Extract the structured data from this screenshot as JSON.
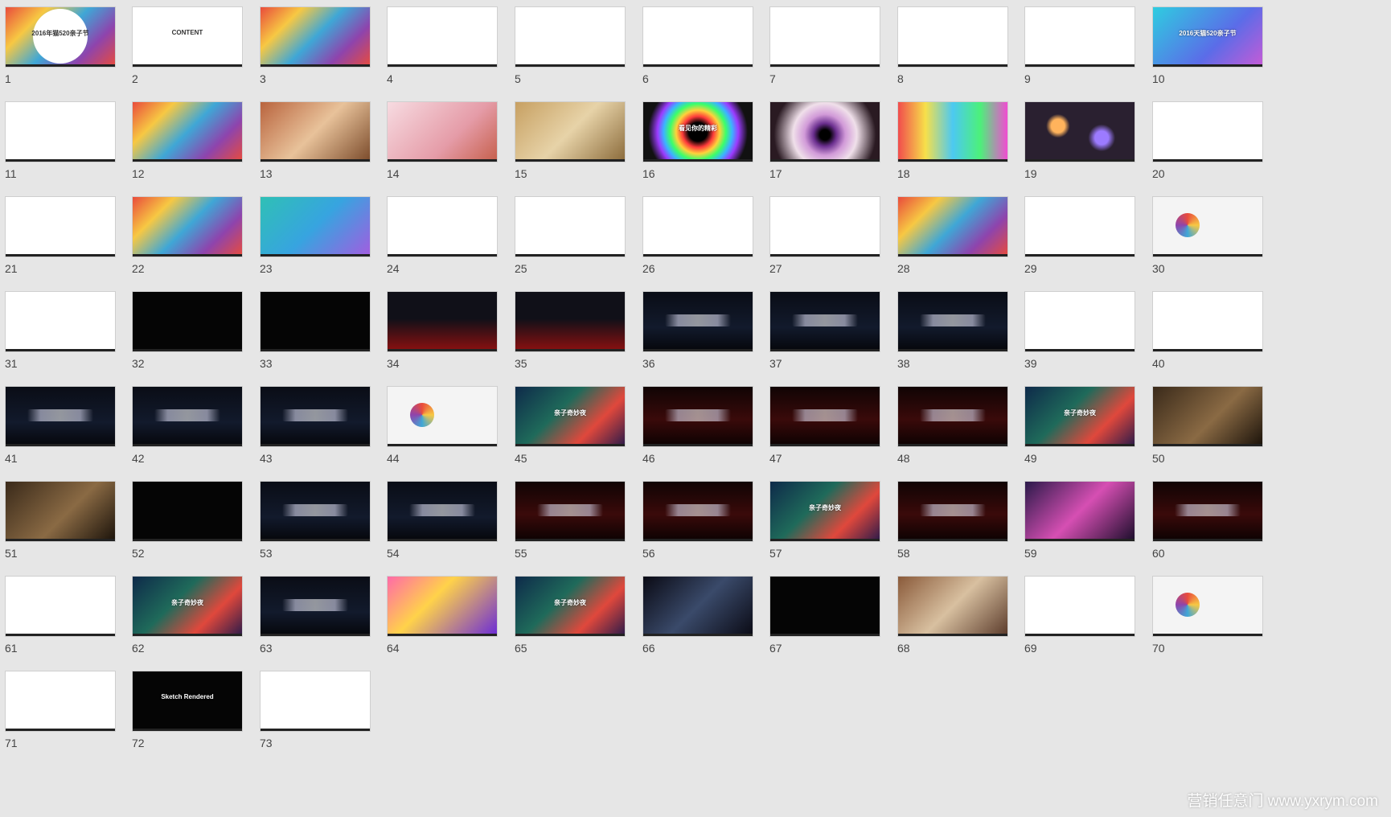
{
  "slides": [
    {
      "num": "1",
      "style": "colorful",
      "caption": "2016年猫520亲子节"
    },
    {
      "num": "2",
      "style": "white",
      "caption": "CONTENT"
    },
    {
      "num": "3",
      "style": "colorful",
      "caption": ""
    },
    {
      "num": "4",
      "style": "white",
      "caption": ""
    },
    {
      "num": "5",
      "style": "white",
      "caption": ""
    },
    {
      "num": "6",
      "style": "white",
      "caption": ""
    },
    {
      "num": "7",
      "style": "white",
      "caption": ""
    },
    {
      "num": "8",
      "style": "white",
      "caption": ""
    },
    {
      "num": "9",
      "style": "white",
      "caption": ""
    },
    {
      "num": "10",
      "style": "cyan",
      "caption": "2016天猫520亲子节"
    },
    {
      "num": "11",
      "style": "white",
      "caption": ""
    },
    {
      "num": "12",
      "style": "colorful",
      "caption": ""
    },
    {
      "num": "13",
      "style": "warm",
      "caption": ""
    },
    {
      "num": "14",
      "style": "pink",
      "caption": ""
    },
    {
      "num": "15",
      "style": "tan",
      "caption": ""
    },
    {
      "num": "16",
      "style": "rainbow",
      "caption": "看见你的精彩"
    },
    {
      "num": "17",
      "style": "eye",
      "caption": ""
    },
    {
      "num": "18",
      "style": "candy",
      "caption": ""
    },
    {
      "num": "19",
      "style": "bokeh",
      "caption": ""
    },
    {
      "num": "20",
      "style": "white",
      "caption": ""
    },
    {
      "num": "21",
      "style": "white",
      "caption": ""
    },
    {
      "num": "22",
      "style": "colorful",
      "caption": ""
    },
    {
      "num": "23",
      "style": "teal",
      "caption": ""
    },
    {
      "num": "24",
      "style": "white",
      "caption": ""
    },
    {
      "num": "25",
      "style": "white",
      "caption": ""
    },
    {
      "num": "26",
      "style": "white",
      "caption": ""
    },
    {
      "num": "27",
      "style": "white",
      "caption": ""
    },
    {
      "num": "28",
      "style": "colorful",
      "caption": ""
    },
    {
      "num": "29",
      "style": "white",
      "caption": ""
    },
    {
      "num": "30",
      "style": "grey",
      "caption": ""
    },
    {
      "num": "31",
      "style": "white",
      "caption": ""
    },
    {
      "num": "32",
      "style": "black",
      "caption": ""
    },
    {
      "num": "33",
      "style": "black",
      "caption": ""
    },
    {
      "num": "34",
      "style": "redfloor",
      "caption": ""
    },
    {
      "num": "35",
      "style": "redfloor",
      "caption": ""
    },
    {
      "num": "36",
      "style": "dark",
      "caption": ""
    },
    {
      "num": "37",
      "style": "dark",
      "caption": ""
    },
    {
      "num": "38",
      "style": "dark",
      "caption": ""
    },
    {
      "num": "39",
      "style": "white",
      "caption": ""
    },
    {
      "num": "40",
      "style": "white",
      "caption": ""
    },
    {
      "num": "41",
      "style": "dark",
      "caption": ""
    },
    {
      "num": "42",
      "style": "dark",
      "caption": ""
    },
    {
      "num": "43",
      "style": "dark",
      "caption": ""
    },
    {
      "num": "44",
      "style": "grey",
      "caption": ""
    },
    {
      "num": "45",
      "style": "jungle",
      "caption": "亲子奇妙夜"
    },
    {
      "num": "46",
      "style": "darkred",
      "caption": ""
    },
    {
      "num": "47",
      "style": "darkred",
      "caption": ""
    },
    {
      "num": "48",
      "style": "darkred",
      "caption": ""
    },
    {
      "num": "49",
      "style": "jungle",
      "caption": "亲子奇妙夜"
    },
    {
      "num": "50",
      "style": "brown",
      "caption": ""
    },
    {
      "num": "51",
      "style": "brown",
      "caption": ""
    },
    {
      "num": "52",
      "style": "black",
      "caption": ""
    },
    {
      "num": "53",
      "style": "dark",
      "caption": ""
    },
    {
      "num": "54",
      "style": "dark",
      "caption": ""
    },
    {
      "num": "55",
      "style": "darkred",
      "caption": ""
    },
    {
      "num": "56",
      "style": "darkred",
      "caption": ""
    },
    {
      "num": "57",
      "style": "jungle",
      "caption": "亲子奇妙夜"
    },
    {
      "num": "58",
      "style": "darkred",
      "caption": ""
    },
    {
      "num": "59",
      "style": "purple",
      "caption": ""
    },
    {
      "num": "60",
      "style": "darkred",
      "caption": ""
    },
    {
      "num": "61",
      "style": "white",
      "caption": ""
    },
    {
      "num": "62",
      "style": "jungle",
      "caption": "亲子奇妙夜"
    },
    {
      "num": "63",
      "style": "dark",
      "caption": ""
    },
    {
      "num": "64",
      "style": "party",
      "caption": ""
    },
    {
      "num": "65",
      "style": "jungle",
      "caption": "亲子奇妙夜"
    },
    {
      "num": "66",
      "style": "dragon",
      "caption": ""
    },
    {
      "num": "67",
      "style": "black",
      "caption": ""
    },
    {
      "num": "68",
      "style": "office",
      "caption": ""
    },
    {
      "num": "69",
      "style": "white",
      "caption": ""
    },
    {
      "num": "70",
      "style": "grey",
      "caption": ""
    },
    {
      "num": "71",
      "style": "white",
      "caption": ""
    },
    {
      "num": "72",
      "style": "black",
      "caption": "Sketch Rendered"
    },
    {
      "num": "73",
      "style": "white",
      "caption": ""
    }
  ],
  "watermark": "营销任意门 www.yxrym.com"
}
